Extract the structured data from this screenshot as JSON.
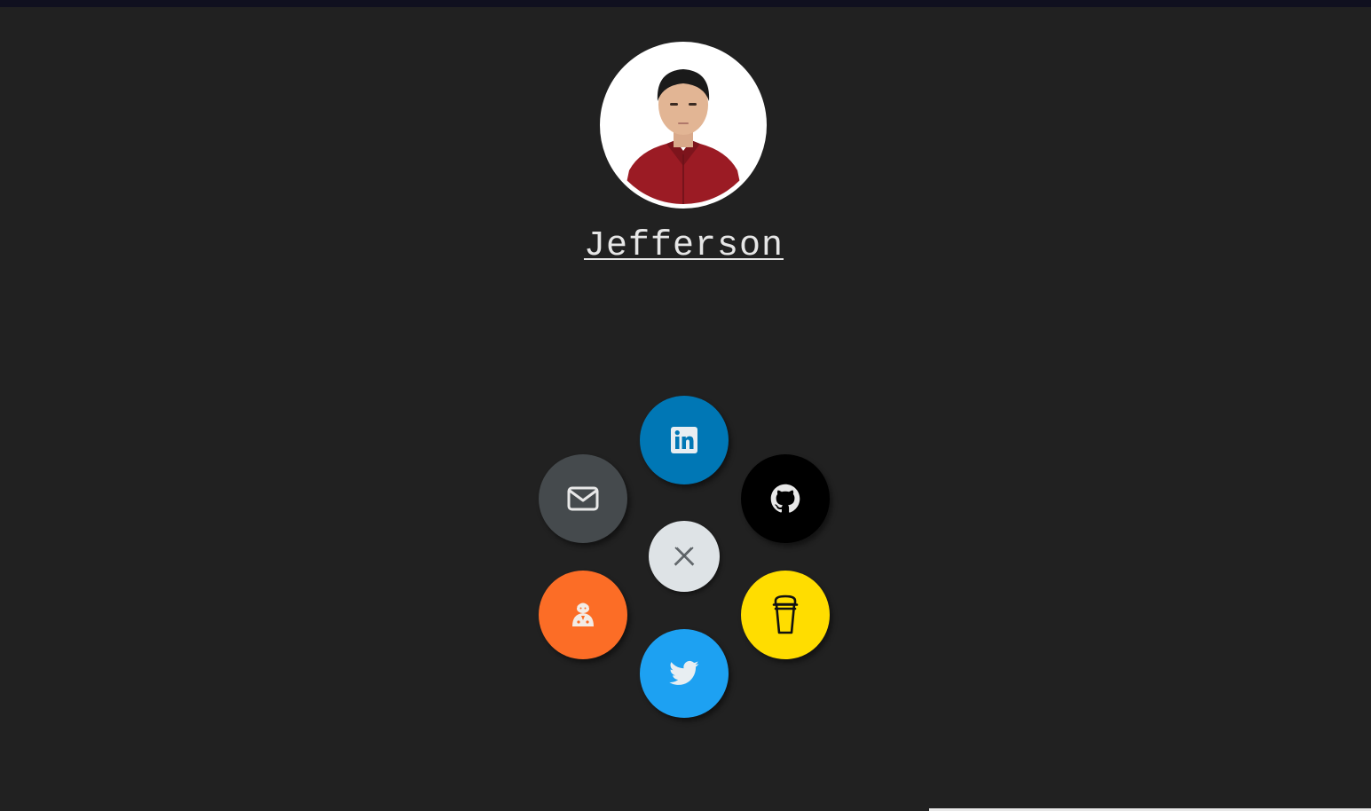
{
  "profile": {
    "name": "Jefferson"
  },
  "social": [
    {
      "id": "linkedin",
      "icon": "linkedin-icon",
      "color": "#0077b5"
    },
    {
      "id": "github",
      "icon": "github-icon",
      "color": "#000000"
    },
    {
      "id": "buymeacoffee",
      "icon": "coffee-cup-icon",
      "color": "#ffdd00"
    },
    {
      "id": "twitter",
      "icon": "twitter-icon",
      "color": "#1da1f2"
    },
    {
      "id": "orange-service",
      "icon": "mascot-icon",
      "color": "#fc6d26"
    },
    {
      "id": "email",
      "icon": "mail-icon",
      "color": "#454a4d"
    }
  ],
  "toggle": {
    "icon": "close-icon",
    "color": "#dee3e6",
    "state": "open"
  },
  "colors": {
    "background": "#212121",
    "text": "#e6e6e6"
  }
}
